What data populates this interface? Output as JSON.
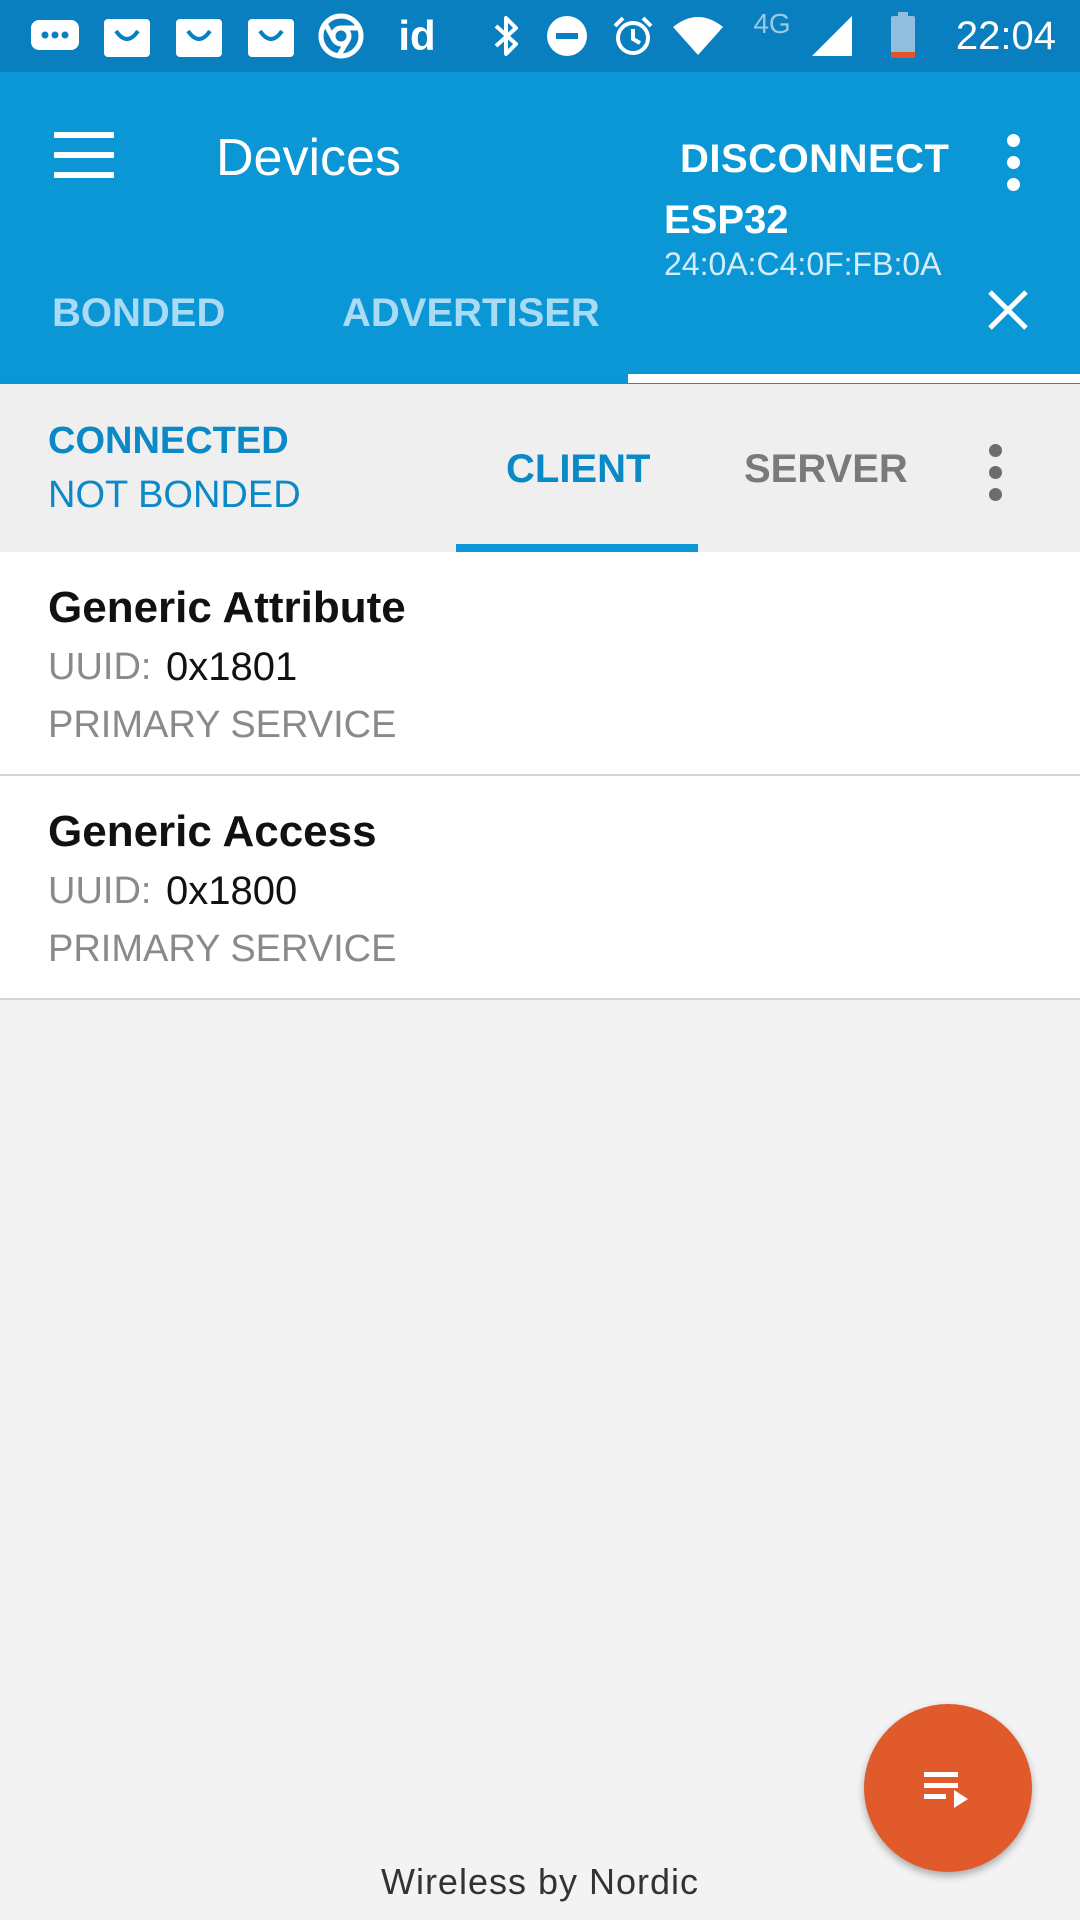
{
  "status_bar": {
    "time": "22:04",
    "network_label": "4G",
    "app_icon_label": "id",
    "icons": [
      "message-icon",
      "shop-icon",
      "shop-icon",
      "shop-icon",
      "chrome-icon",
      "id-app-icon",
      "bluetooth-icon",
      "do-not-disturb-icon",
      "alarm-icon",
      "wifi-icon",
      "cellular-signal-icon",
      "battery-low-icon"
    ],
    "battery_level": 0.1,
    "colors": {
      "background": "#0a7fbf",
      "battery_low": "#e8522a"
    }
  },
  "app_bar": {
    "title": "Devices",
    "action_label": "DISCONNECT",
    "menu_icon": "hamburger-menu-icon",
    "overflow_icon": "more-vert-icon",
    "color": "#0b97d6"
  },
  "device_tabs": {
    "items": [
      {
        "label": "BONDED"
      },
      {
        "label": "ADVERTISER"
      }
    ],
    "active_device": {
      "name": "ESP32",
      "address": "24:0A:C4:0F:FB:0A"
    }
  },
  "connection": {
    "state": "CONNECTED",
    "bond_state": "NOT BONDED",
    "tabs": [
      {
        "label": "CLIENT",
        "active": true
      },
      {
        "label": "SERVER",
        "active": false
      }
    ],
    "accent": "#0a89c6"
  },
  "services": [
    {
      "name": "Generic Attribute",
      "uuid_label": "UUID:",
      "uuid": "0x1801",
      "type": "PRIMARY SERVICE"
    },
    {
      "name": "Generic Access",
      "uuid_label": "UUID:",
      "uuid": "0x1800",
      "type": "PRIMARY SERVICE"
    }
  ],
  "fab": {
    "icon": "log-playlist-icon",
    "color": "#e05a2b"
  },
  "footer": {
    "text": "Wireless by Nordic"
  }
}
